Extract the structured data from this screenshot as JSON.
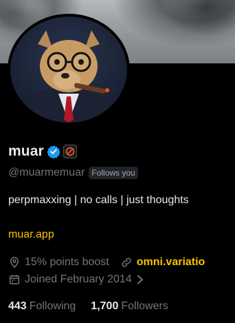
{
  "profile": {
    "display_name": "muar",
    "handle": "@muarmemuar",
    "follows_you": "Follows you",
    "bio": "perpmaxxing | no calls | just thoughts",
    "website": "muar.app",
    "meta": {
      "points_boost": "15% points boost",
      "link": "omni.variatio",
      "joined": "Joined February 2014"
    },
    "stats": {
      "following_count": "443",
      "following_label": "Following",
      "followers_count": "1,700",
      "followers_label": "Followers"
    }
  },
  "icons": {
    "verified": "verified-badge-icon",
    "affiliate": "affiliate-badge-icon",
    "location": "location-pin-icon",
    "link": "link-icon",
    "calendar": "calendar-icon",
    "chevron": "chevron-right-icon"
  },
  "colors": {
    "background": "#000000",
    "text_primary": "#e7e9ea",
    "text_secondary": "#71767b",
    "link_accent": "#f5c400",
    "verified_blue": "#1d9bf0"
  }
}
